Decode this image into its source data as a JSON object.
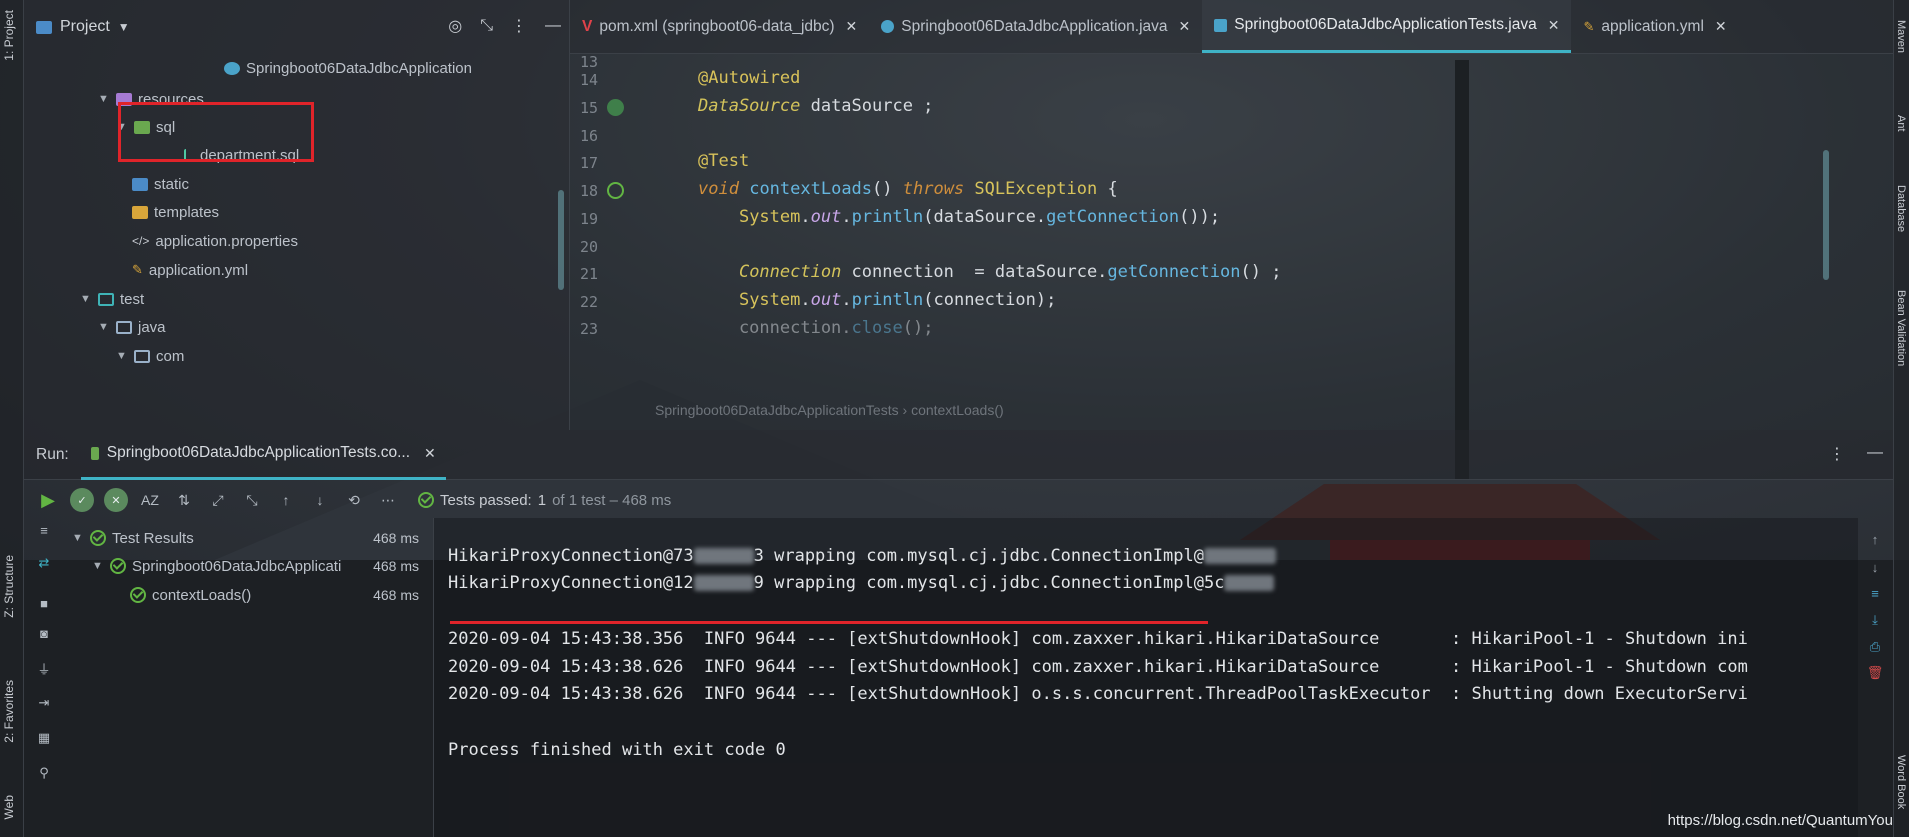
{
  "left_strip": {
    "project_label": "1: Project",
    "structure_label": "Z: Structure",
    "favorites_label": "2: Favorites",
    "web_label": "Web"
  },
  "right_strip": {
    "maven_label": "Maven",
    "ant_label": "Ant",
    "database_label": "Database",
    "bean_validation_label": "Bean Validation",
    "word_book_label": "Word Book"
  },
  "project_panel": {
    "title": "Project",
    "tree": [
      {
        "label": "Springboot06DataJdbcApplication",
        "icon": "spring-class-icon"
      },
      {
        "label": "resources",
        "icon": "folder-resources-icon"
      },
      {
        "label": "sql",
        "icon": "folder-icon"
      },
      {
        "label": "department.sql",
        "icon": "sql-file-icon"
      },
      {
        "label": "static",
        "icon": "folder-icon"
      },
      {
        "label": "templates",
        "icon": "folder-icon"
      },
      {
        "label": "application.properties",
        "icon": "properties-file-icon"
      },
      {
        "label": "application.yml",
        "icon": "yaml-file-icon"
      },
      {
        "label": "test",
        "icon": "folder-test-icon"
      },
      {
        "label": "java",
        "icon": "folder-icon"
      },
      {
        "label": "com",
        "icon": "folder-icon"
      }
    ]
  },
  "editor": {
    "tabs": [
      {
        "label": "pom.xml (springboot06-data_jdbc)",
        "icon": "maven-icon"
      },
      {
        "label": "Springboot06DataJdbcApplication.java",
        "icon": "spring-class-icon"
      },
      {
        "label": "Springboot06DataJdbcApplicationTests.java",
        "icon": "test-class-icon"
      },
      {
        "label": "application.yml",
        "icon": "yaml-file-icon"
      }
    ],
    "line_numbers": [
      "13",
      "14",
      "15",
      "16",
      "17",
      "18",
      "19",
      "20",
      "21",
      "22",
      "23"
    ],
    "breadcrumb": [
      "Springboot06DataJdbcApplicationTests",
      "contextLoads()"
    ]
  },
  "run_panel": {
    "label": "Run:",
    "tab_label": "Springboot06DataJdbcApplicationTests.co...",
    "tests_passed_prefix": "Tests passed:",
    "tests_passed_count": "1",
    "tests_passed_detail": "of 1 test – 468 ms",
    "results": [
      {
        "label": "Test Results",
        "time": "468 ms"
      },
      {
        "label": "Springboot06DataJdbcApplicati",
        "time": "468 ms"
      },
      {
        "label": "contextLoads()",
        "time": "468 ms"
      }
    ]
  },
  "console": {
    "line1_prefix": "HikariProxyConnection@73",
    "line1_mid": "3 wrapping com.mysql.cj.jdbc.ConnectionImpl@",
    "line2_prefix": "HikariProxyConnection@12",
    "line2_mid": "9 wrapping com.mysql.cj.jdbc.ConnectionImpl@5c",
    "logs": [
      "2020-09-04 15:43:38.356  INFO 9644 --- [extShutdownHook] com.zaxxer.hikari.HikariDataSource       : HikariPool-1 - Shutdown ini",
      "2020-09-04 15:43:38.626  INFO 9644 --- [extShutdownHook] com.zaxxer.hikari.HikariDataSource       : HikariPool-1 - Shutdown com",
      "2020-09-04 15:43:38.626  INFO 9644 --- [extShutdownHook] o.s.s.concurrent.ThreadPoolTaskExecutor  : Shutting down ExecutorServi"
    ],
    "exit_message": "Process finished with exit code 0"
  },
  "watermark": "https://blog.csdn.net/QuantumYou",
  "colors": {
    "accent": "#3fb3c6",
    "highlight_red": "#e0242a",
    "pass_green": "#62b543"
  }
}
